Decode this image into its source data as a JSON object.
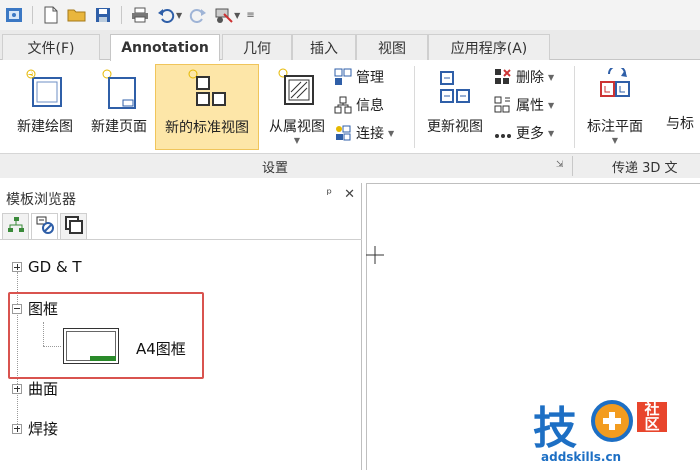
{
  "tabs": [
    {
      "label": "文件(F)"
    },
    {
      "label": "Annotation"
    },
    {
      "label": "几何"
    },
    {
      "label": "插入"
    },
    {
      "label": "视图"
    },
    {
      "label": "应用程序(A)"
    }
  ],
  "ribbon": {
    "new_drawing": "新建绘图",
    "new_page": "新建页面",
    "new_standard_view": "新的标准视图",
    "dependent_view": "从属视图",
    "manage": "管理",
    "info": "信息",
    "connect": "连接",
    "update_view": "更新视图",
    "delete": "删除",
    "properties": "属性",
    "more": "更多",
    "annotation_plane": "标注平面",
    "with_label": "与标",
    "group_settings": "设置",
    "group_transfer": "传递 3D 文"
  },
  "panel": {
    "title": "模板浏览器",
    "pin": "ᵖ",
    "close": "✕",
    "tree": [
      {
        "label": "GD & T"
      },
      {
        "label": "图框"
      },
      {
        "label": "A4图框"
      },
      {
        "label": "曲面"
      },
      {
        "label": "焊接"
      }
    ]
  },
  "watermark": {
    "char": "技",
    "she": "社",
    "qu": "区",
    "url": "addskills.cn"
  },
  "colors": {
    "accent": "#1d6fc4",
    "highlight": "#d9534f",
    "selected_bg": "#fde6a8"
  }
}
